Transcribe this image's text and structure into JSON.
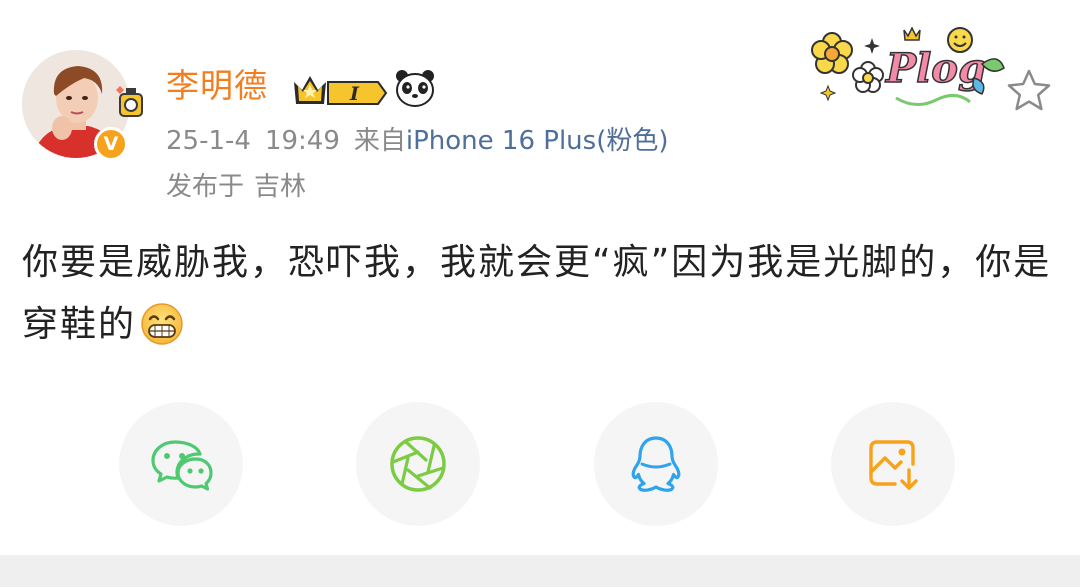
{
  "post": {
    "author_name": "李明德",
    "level_badge": "I",
    "verified_mark": "V",
    "date": "25-1-4",
    "time": "19:49",
    "source_prefix": "来自",
    "source_device": "iPhone 16 Plus(粉色)",
    "location_prefix": "发布于",
    "location": "吉林",
    "content": "你要是威胁我，恐吓我，我就会更“疯”因为我是光脚的，你是穿鞋的",
    "decoration_text": "Plog"
  },
  "icons": {
    "favorite": "star-outline-icon",
    "emoji": "grinning-face-emoji",
    "sticker": "panda-icon"
  },
  "share_options": [
    {
      "name": "wechat",
      "icon": "wechat-icon",
      "color": "#4fc971"
    },
    {
      "name": "moments",
      "icon": "moments-shutter-icon",
      "color": "#7ccc43"
    },
    {
      "name": "qq",
      "icon": "qq-penguin-icon",
      "color": "#2fa4ee"
    },
    {
      "name": "save-image",
      "icon": "save-image-icon",
      "color": "#f7a21b"
    }
  ],
  "colors": {
    "name": "#f37e1f",
    "meta": "#8a8a8a",
    "source_link": "#4f6f9a",
    "text": "#222222",
    "share_bg": "#f5f5f5"
  }
}
